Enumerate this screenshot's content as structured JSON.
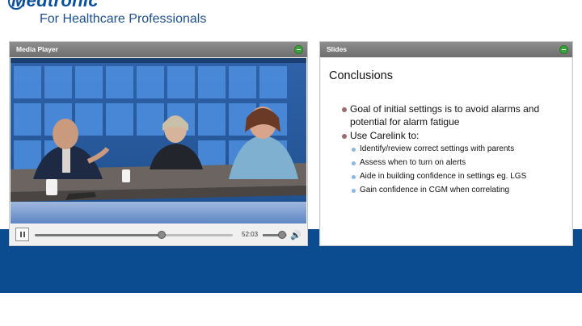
{
  "header": {
    "brand": "Medtronic",
    "tagline": "For Healthcare Professionals"
  },
  "media_player": {
    "title": "Media Player",
    "time": "52:03",
    "progress": 0.64,
    "volume": 0.8
  },
  "slides_panel": {
    "title": "Slides",
    "slide": {
      "title": "Conclusions",
      "bullets": [
        {
          "text": "Goal of initial settings is to avoid alarms and potential for alarm fatigue",
          "sub": []
        },
        {
          "text": "Use Carelink to:",
          "sub": [
            "Identify/review  correct settings with parents",
            "Assess when to turn on alerts",
            "Aide in building confidence in settings eg. LGS",
            "Gain confidence in CGM when correlating"
          ]
        }
      ]
    }
  },
  "colors": {
    "brand_blue": "#0a4f9c",
    "band_blue": "#0b4b8f",
    "panel_header": "#7a7a7a",
    "window_button": "#3aa43a",
    "bullet_primary": "#9b6b6e",
    "bullet_secondary": "#89b7de"
  },
  "icons": {
    "window_button": "green-minimize-icon",
    "pause": "pause-icon",
    "volume": "speaker-icon"
  }
}
